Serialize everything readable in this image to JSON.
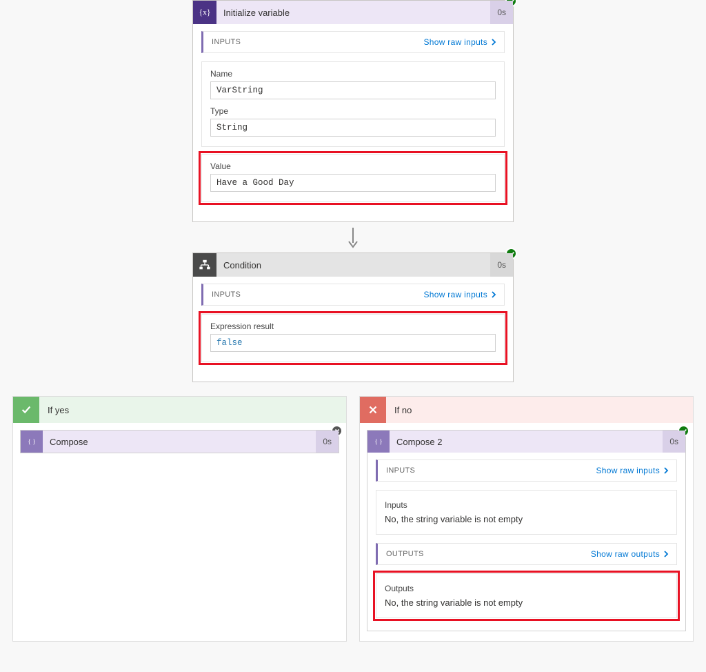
{
  "init_var": {
    "title": "Initialize variable",
    "duration": "0s",
    "inputs_label": "INPUTS",
    "show_raw_inputs": "Show raw inputs",
    "name_label": "Name",
    "name_value": "VarString",
    "type_label": "Type",
    "type_value": "String",
    "value_label": "Value",
    "value_value": "Have a Good Day"
  },
  "condition": {
    "title": "Condition",
    "duration": "0s",
    "inputs_label": "INPUTS",
    "show_raw_inputs": "Show raw inputs",
    "expr_label": "Expression result",
    "expr_value": "false"
  },
  "branch_yes": {
    "title": "If yes",
    "compose_title": "Compose",
    "duration": "0s"
  },
  "branch_no": {
    "title": "If no",
    "compose_title": "Compose 2",
    "duration": "0s",
    "inputs_label": "INPUTS",
    "show_raw_inputs": "Show raw inputs",
    "inputs_field_label": "Inputs",
    "inputs_value": "No, the string variable is not empty",
    "outputs_label": "OUTPUTS",
    "show_raw_outputs": "Show raw outputs",
    "outputs_field_label": "Outputs",
    "outputs_value": "No, the string variable is not empty"
  }
}
